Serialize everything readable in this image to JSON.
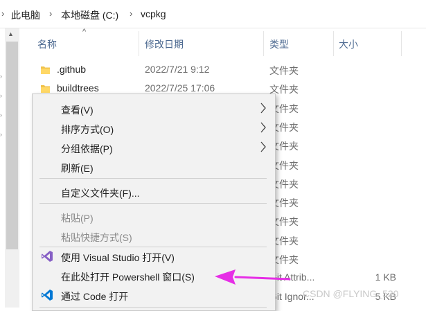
{
  "breadcrumb": {
    "items": [
      "此电脑",
      "本地磁盘 (C:)",
      "vcpkg"
    ],
    "separator": "›"
  },
  "columns": {
    "name": "名称",
    "date": "修改日期",
    "type": "类型",
    "size": "大小"
  },
  "files": [
    {
      "name": ".github",
      "date": "2022/7/21 9:12",
      "type": "文件夹",
      "size": ""
    },
    {
      "name": "buildtrees",
      "date": "2022/7/25 17:06",
      "type": "文件夹",
      "size": ""
    },
    {
      "name": "",
      "date": "",
      "type": "文件夹",
      "size": ""
    },
    {
      "name": "",
      "date": "",
      "type": "文件夹",
      "size": ""
    },
    {
      "name": "",
      "date": "",
      "type": "文件夹",
      "size": ""
    },
    {
      "name": "",
      "date": "",
      "type": "文件夹",
      "size": ""
    },
    {
      "name": "",
      "date": "",
      "type": "文件夹",
      "size": ""
    },
    {
      "name": "",
      "date": "",
      "type": "文件夹",
      "size": ""
    },
    {
      "name": "",
      "date": "",
      "type": "文件夹",
      "size": ""
    },
    {
      "name": "",
      "date": "",
      "type": "文件夹",
      "size": ""
    },
    {
      "name": "",
      "date": "",
      "type": "文件夹",
      "size": ""
    },
    {
      "name": "",
      "date": "",
      "type": "Git Attrib...",
      "size": "1 KB"
    },
    {
      "name": "",
      "date": "",
      "type": "Git Ignor...",
      "size": "5 KB"
    }
  ],
  "context_menu": {
    "view": "查看(V)",
    "sort": "排序方式(O)",
    "group": "分组依据(P)",
    "refresh": "刷新(E)",
    "customize": "自定义文件夹(F)...",
    "paste": "粘贴(P)",
    "paste_shortcut": "粘贴快捷方式(S)",
    "open_vs": "使用 Visual Studio 打开(V)",
    "open_powershell": "在此处打开 Powershell 窗口(S)",
    "open_code": "通过 Code 打开"
  },
  "colors": {
    "header_text": "#4d6a91",
    "folder": "#f0c24b",
    "annotation_arrow": "#e62ee6",
    "vs_purple": "#865fc5",
    "vscode_blue": "#0078d4"
  },
  "icons": {
    "folder": "folder-icon",
    "vs": "visual-studio-icon",
    "code": "vscode-icon",
    "submenu": "chevron-right-icon"
  },
  "watermark": "CSDN @FLYING_520"
}
